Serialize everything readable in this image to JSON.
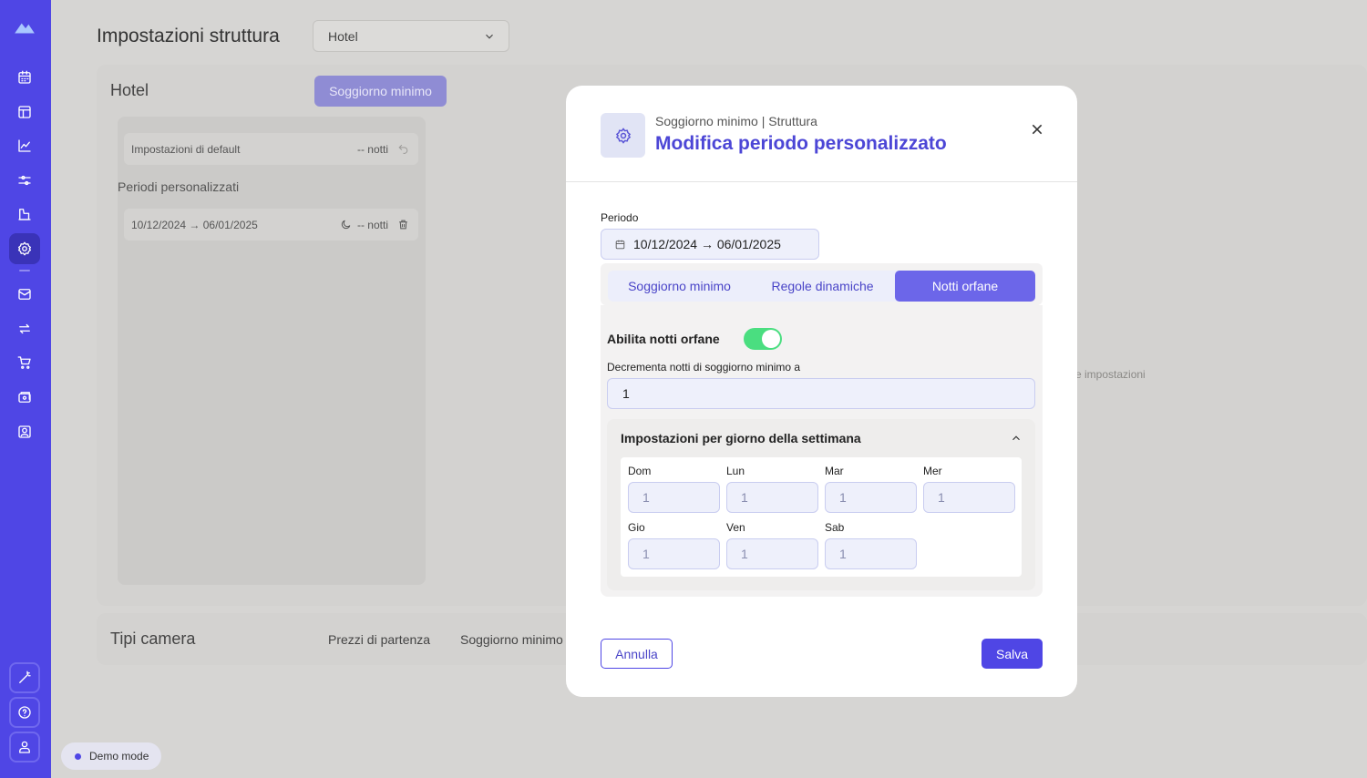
{
  "sidebar": {
    "icons": [
      "logo-icon",
      "calendar-icon",
      "layout-icon",
      "chart-icon",
      "sliders-icon",
      "building-icon",
      "settings-icon",
      "mail-icon",
      "sync-icon",
      "cart-icon",
      "wallet-icon",
      "user-card-icon"
    ],
    "bottom_icons": [
      "magic-wand-icon",
      "help-icon",
      "user-icon"
    ],
    "active": "settings-icon",
    "accent": "#4f46e5"
  },
  "page": {
    "title": "Impostazioni struttura",
    "structure_select": "Hotel",
    "hotel_panel": {
      "title": "Hotel",
      "min_stay_button": "Soggiorno minimo",
      "default_settings_label": "Impostazioni di default",
      "default_settings_value": "-- notti",
      "custom_periods_label": "Periodi personalizzati",
      "period_range": "10/12/2024 → 06/01/2025",
      "period_value": "-- notti",
      "hint_text": "e impostazioni"
    },
    "rooms_panel": {
      "title": "Tipi camera",
      "tabs": [
        "Prezzi di partenza",
        "Soggiorno minimo"
      ]
    },
    "demo_mode": "Demo mode"
  },
  "modal": {
    "subtitle": "Soggiorno minimo | Struttura",
    "title": "Modifica periodo personalizzato",
    "period_label": "Periodo",
    "period_value": "10/12/2024 → 06/01/2025",
    "tabs": [
      "Soggiorno minimo",
      "Regole dinamiche",
      "Notti orfane"
    ],
    "active_tab": "Notti orfane",
    "enable_orphan_label": "Abilita notti orfane",
    "enable_orphan": true,
    "decrement_label": "Decrementa notti di soggiorno minimo a",
    "decrement_value": "1",
    "weekday_section_title": "Impostazioni per giorno della settimana",
    "weekdays": [
      {
        "label": "Dom",
        "value": "1"
      },
      {
        "label": "Lun",
        "value": "1"
      },
      {
        "label": "Mar",
        "value": "1"
      },
      {
        "label": "Mer",
        "value": "1"
      },
      {
        "label": "Gio",
        "value": "1"
      },
      {
        "label": "Ven",
        "value": "1"
      },
      {
        "label": "Sab",
        "value": "1"
      }
    ],
    "cancel_label": "Annulla",
    "save_label": "Salva",
    "toggle_color": "#4ade80"
  }
}
